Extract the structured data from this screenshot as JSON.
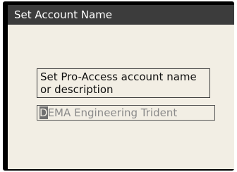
{
  "window": {
    "title": "Set Account Name"
  },
  "dialog": {
    "prompt_line1": "Set Pro-Access account name",
    "prompt_line2": "or description"
  },
  "account_name_input": {
    "cursor_char": "D",
    "value_rest": "EMA Engineering Trident"
  },
  "colors": {
    "title_bar": "#3c3c3c",
    "screen_background": "#f2eee4",
    "frame": "#000000"
  }
}
